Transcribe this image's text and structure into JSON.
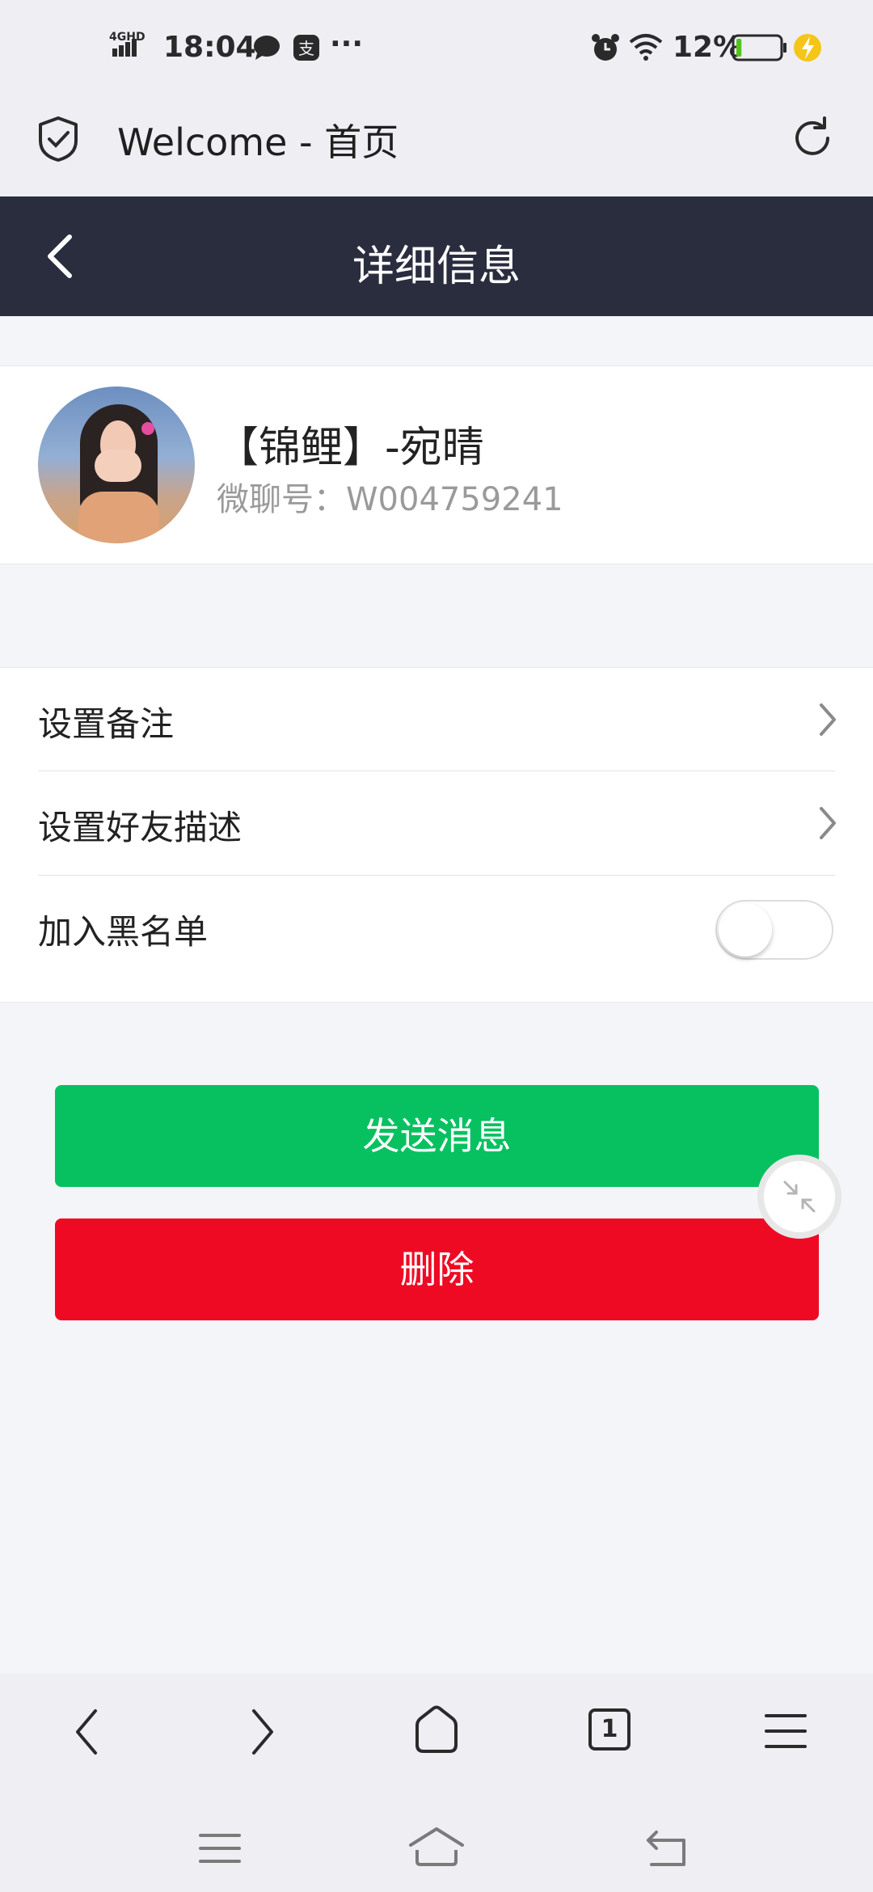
{
  "status_bar": {
    "network": "4GHD",
    "time": "18:04",
    "battery_percent": "12%",
    "battery_level": 0.12,
    "more": "···"
  },
  "browser": {
    "page_title": "Welcome - 首页",
    "tab_count": "1"
  },
  "navbar": {
    "title": "详细信息"
  },
  "profile": {
    "name": "【锦鲤】-宛晴",
    "wechat_id": "微聊号：W004759241"
  },
  "settings": {
    "items": [
      {
        "label": "设置备注"
      },
      {
        "label": "设置好友描述"
      },
      {
        "label": "加入黑名单",
        "toggle_on": false
      }
    ]
  },
  "actions": {
    "send_label": "发送消息",
    "delete_label": "删除"
  },
  "colors": {
    "navbar_bg": "#2a2d3e",
    "send_green": "#07c160",
    "delete_red": "#ef0a24",
    "battery_green": "#52c41a",
    "charge_yellow": "#f5c518"
  }
}
